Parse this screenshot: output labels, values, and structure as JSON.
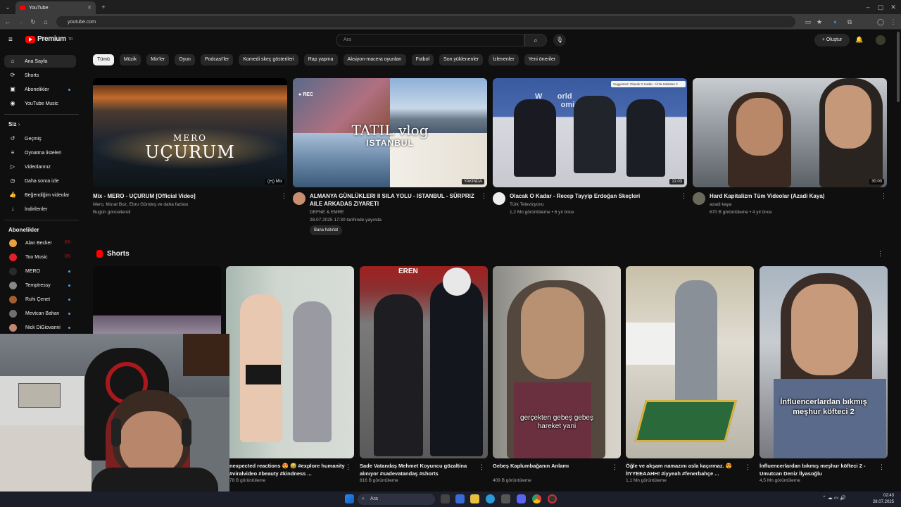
{
  "browser": {
    "tab_title": "YouTube",
    "url": "youtube.com"
  },
  "header": {
    "logo_text": "Premium",
    "logo_sup": "TR",
    "search_placeholder": "Ara",
    "create_label": "Oluştur"
  },
  "sidebar": {
    "main": [
      {
        "label": "Ana Sayfa",
        "icon": "home-icon",
        "glyph": "⌂"
      },
      {
        "label": "Shorts",
        "icon": "shorts-icon",
        "glyph": "⟳"
      },
      {
        "label": "Abonelikler",
        "icon": "subscriptions-icon",
        "glyph": "▣"
      },
      {
        "label": "YouTube Music",
        "icon": "music-icon",
        "glyph": "◉"
      }
    ],
    "you_heading": "Siz",
    "you_items": [
      {
        "label": "Geçmiş",
        "icon": "history-icon",
        "glyph": "↺"
      },
      {
        "label": "Oynatma listeleri",
        "icon": "playlists-icon",
        "glyph": "≡"
      },
      {
        "label": "Videolarınız",
        "icon": "your-videos-icon",
        "glyph": "▷"
      },
      {
        "label": "Daha sonra izle",
        "icon": "watch-later-icon",
        "glyph": "◷"
      },
      {
        "label": "Beğendiğim videolar",
        "icon": "liked-icon",
        "glyph": "👍"
      },
      {
        "label": "İndirilenler",
        "icon": "downloads-icon",
        "glyph": "↓"
      }
    ],
    "subs_heading": "Abonelikler",
    "subs": [
      {
        "label": "Alan Becker",
        "color": "#e8a040",
        "live": true
      },
      {
        "label": "Too Music",
        "color": "#e0202a",
        "live": true
      },
      {
        "label": "MERO",
        "color": "#2a2a2a",
        "live": false
      },
      {
        "label": "Temptressy",
        "color": "#888888",
        "live": false
      },
      {
        "label": "Ruhi Çenet",
        "color": "#a06030",
        "live": false
      },
      {
        "label": "Mevtcan Bahav",
        "color": "#707070",
        "live": false
      },
      {
        "label": "Nick DiGiovanni",
        "color": "#c08870",
        "live": false
      }
    ]
  },
  "chips": [
    "Tümü",
    "Müzik",
    "Mix'ler",
    "Oyun",
    "Podcast'ler",
    "Komedi skeç gösterileri",
    "Rap yapma",
    "Aksiyon-macera oyunları",
    "Futbol",
    "Son yüklenenler",
    "İzlenenler",
    "Yeni öneriler"
  ],
  "videos": [
    {
      "title": "Mix - MERO - UÇURUM [Official Video]",
      "channel": "Mero, Murat Boz, Ebru Gündeş ve daha fazlası",
      "meta": "Bugün güncellendi",
      "badge": "Mix",
      "thumb_text": "MERO\nUÇURUM"
    },
    {
      "title": "ALMANYA GÜNLÜKLERI II SILA YOLU - ISTANBUL - SÜRPRIZ AILE ARKADAS ZIYARETI",
      "channel": "DEFNE & EMRE",
      "meta": "28.07.2025 17:30 tarihinde yayında",
      "badge": "YAKINDA",
      "button": "Bana hatırlat",
      "thumb_text": "TATIL vlog",
      "thumb_sub": "ISTANBUL",
      "rec": "REC"
    },
    {
      "title": "Olacak O Kadar - Recep Tayyip Erdoğan Skeçleri",
      "channel": "Türk Televizyonu",
      "meta": "1,2 Mn görüntüleme • 6 yıl önce",
      "badge": "11:03",
      "suggested": "Suggested: Olacak O Kadar · Ünlü Sülaleler 2"
    },
    {
      "title": "Hard Kapitalizm Tüm Videolar (Azadi Kaya)",
      "channel": "azadi kaya",
      "meta": "670 B görüntüleme • 4 yıl önce",
      "badge": "30:00"
    }
  ],
  "shorts_heading": "Shorts",
  "shorts": [
    {
      "title": "nexpected reactions 😍 😅 #explore humanity #viralvideo #beauty #kindness ...",
      "views": "78 B görüntüleme"
    },
    {
      "title": "Sade Vatandaş Mehmet Koyuncu gözaltina alınıyor #sadevatandaş #shorts",
      "views": "816 B görüntüleme",
      "shop_sign": "EREN"
    },
    {
      "title": "Gebeş Kaplumbağanın Anlamı",
      "views": "409 B görüntüleme",
      "caption": "gerçekten gebeş gebeş hareket yani"
    },
    {
      "title": "Öğle ve akşam namazını asla kaçırmaz. 😍 İIYYEEAAHH! #iyyeah #fenerbahçe ...",
      "views": "1,1 Mn görüntüleme"
    },
    {
      "title": "İnfluencerlardan bıkmış meşhur köfteci 2 - Umutcan Deniz İlyasoğlu",
      "views": "4,5 Mn görüntüleme",
      "caption": "İnfluencerlardan bıkmış meşhur köfteci 2"
    }
  ],
  "taskbar": {
    "search_placeholder": "Ara",
    "time": "02:43",
    "date": "28.07.2025"
  }
}
